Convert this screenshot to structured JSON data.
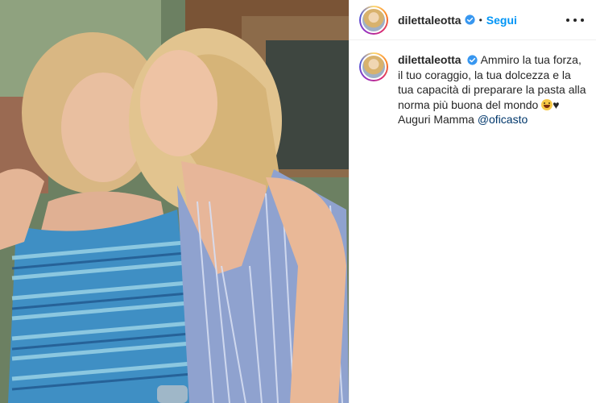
{
  "post": {
    "header": {
      "username": "dilettaleotta",
      "verified_icon": "verified-badge-icon",
      "separator": "•",
      "follow_label": "Segui",
      "more_icon": "more-options-icon"
    },
    "caption": {
      "username": "dilettaleotta",
      "text": "Ammiro la tua forza, il tuo coraggio, la tua dolcezza e la tua capacità di preparare la pasta alla norma più buona del mondo",
      "emoji_icon": "grinning-face-emoji-icon",
      "heart": "♥",
      "text2": "Auguri Mamma",
      "mention": "@oficasto"
    },
    "colors": {
      "link_blue": "#0095f6",
      "mention_blue": "#00376b",
      "verified_blue": "#3897f0"
    }
  }
}
